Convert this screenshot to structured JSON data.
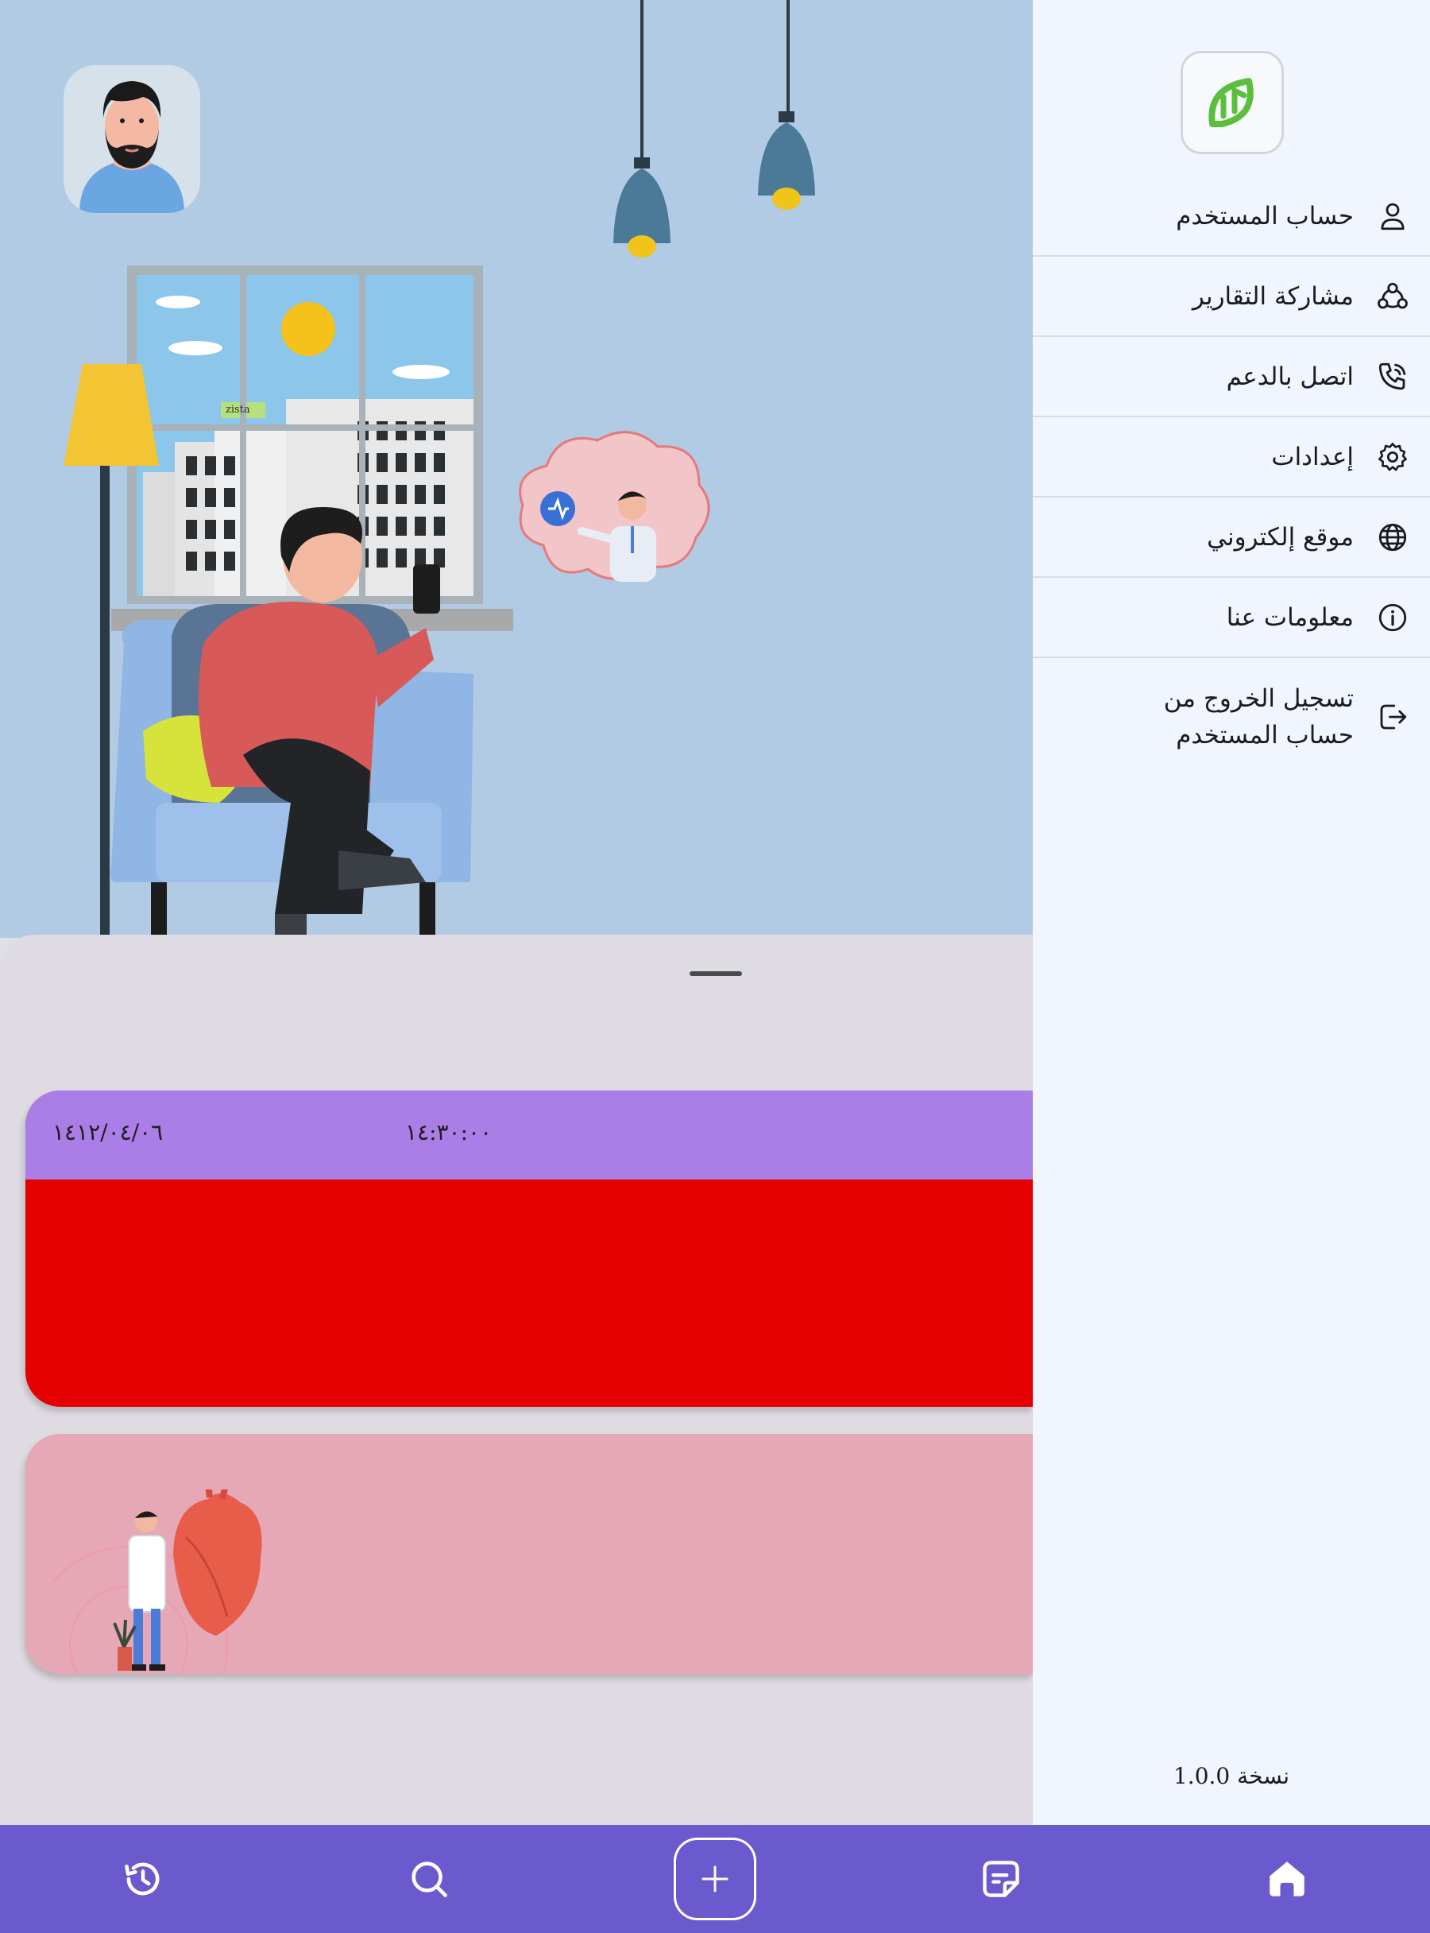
{
  "drawer": {
    "logo": "leaf-logo-icon",
    "items": [
      {
        "label": "حساب المستخدم",
        "icon": "user-icon"
      },
      {
        "label": "مشاركة التقارير",
        "icon": "share-nodes-icon"
      },
      {
        "label": "اتصل بالدعم",
        "icon": "phone-call-icon"
      },
      {
        "label": "إعدادات",
        "icon": "gear-icon"
      },
      {
        "label": "موقع إلكتروني",
        "icon": "globe-icon"
      },
      {
        "label": "معلومات عنا",
        "icon": "info-icon"
      },
      {
        "label": "تسجيل الخروج من حساب المستخدم",
        "icon": "logout-icon"
      }
    ],
    "version": "نسخة 1.0.0"
  },
  "illustration": {
    "sign_text": "zista"
  },
  "card": {
    "date": "١٤١٢/٠٤/٠٦",
    "time": "١٤:٣٠:٠٠"
  },
  "bottom_nav": {
    "items": [
      "history-icon",
      "search-icon",
      "add-icon",
      "report-icon",
      "home-icon"
    ]
  },
  "colors": {
    "drawer_bg": "#f1f5fd",
    "nav_bg": "#6a5acd",
    "card_header": "#aa7ee6",
    "card_body": "#e50000",
    "card_pink": "#e6a7b6",
    "logo_green": "#5bbf3c"
  }
}
